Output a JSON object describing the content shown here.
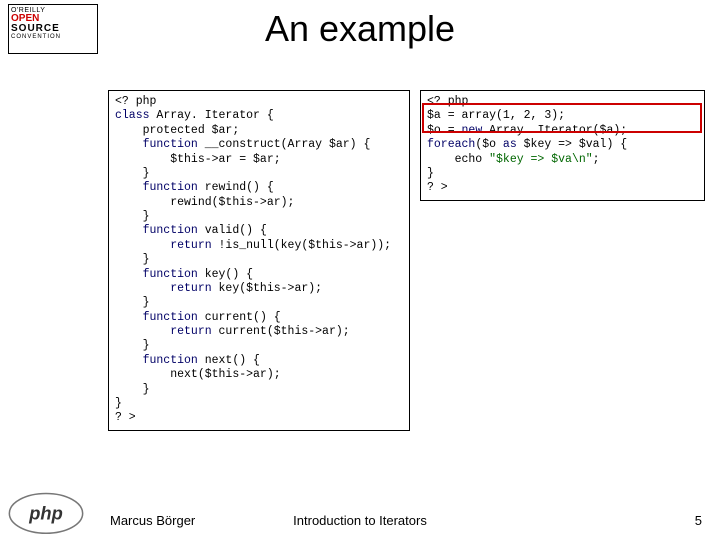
{
  "logo": {
    "line1": "O'REILLY",
    "open": "OPEN",
    "source": "SOURCE",
    "conv": "CONVENTION"
  },
  "title": "An example",
  "code_left": {
    "l1": "<? php",
    "l2": "class",
    "l2b": " Array. Iterator {",
    "l3": "    protected $ar;",
    "l4a": "    function",
    "l4b": " __construct(Array $ar) {",
    "l5": "        $this->ar = $ar;",
    "l6": "    }",
    "l7a": "    function",
    "l7b": " rewind() {",
    "l8": "        rewind($this->ar);",
    "l9": "    }",
    "l10a": "    function",
    "l10b": " valid() {",
    "l11a": "        return",
    "l11b": " !is_null(key($this->ar));",
    "l12": "    }",
    "l13a": "    function",
    "l13b": " key() {",
    "l14a": "        return",
    "l14b": " key($this->ar);",
    "l15": "    }",
    "l16a": "    function",
    "l16b": " current() {",
    "l17a": "        return",
    "l17b": " current($this->ar);",
    "l18": "    }",
    "l19a": "    function",
    "l19b": " next() {",
    "l20": "        next($this->ar);",
    "l21": "    }",
    "l22": "}",
    "l23": "? >"
  },
  "code_right": {
    "r1": "<? php",
    "r2": "$a = array(1, 2, 3);",
    "r3a": "$o = ",
    "r3b": "new",
    "r3c": " Array. Iterator($a);",
    "r4a": "foreach",
    "r4b": "($o ",
    "r4c": "as",
    "r4d": " $key => $val) {",
    "r5a": "    echo ",
    "r5b": "\"$key => $va\\n\"",
    "r5c": ";",
    "r6": "}",
    "r7": "? >"
  },
  "footer": {
    "author": "Marcus Börger",
    "title": "Introduction to Iterators",
    "page": "5"
  },
  "php_logo_text": "php"
}
